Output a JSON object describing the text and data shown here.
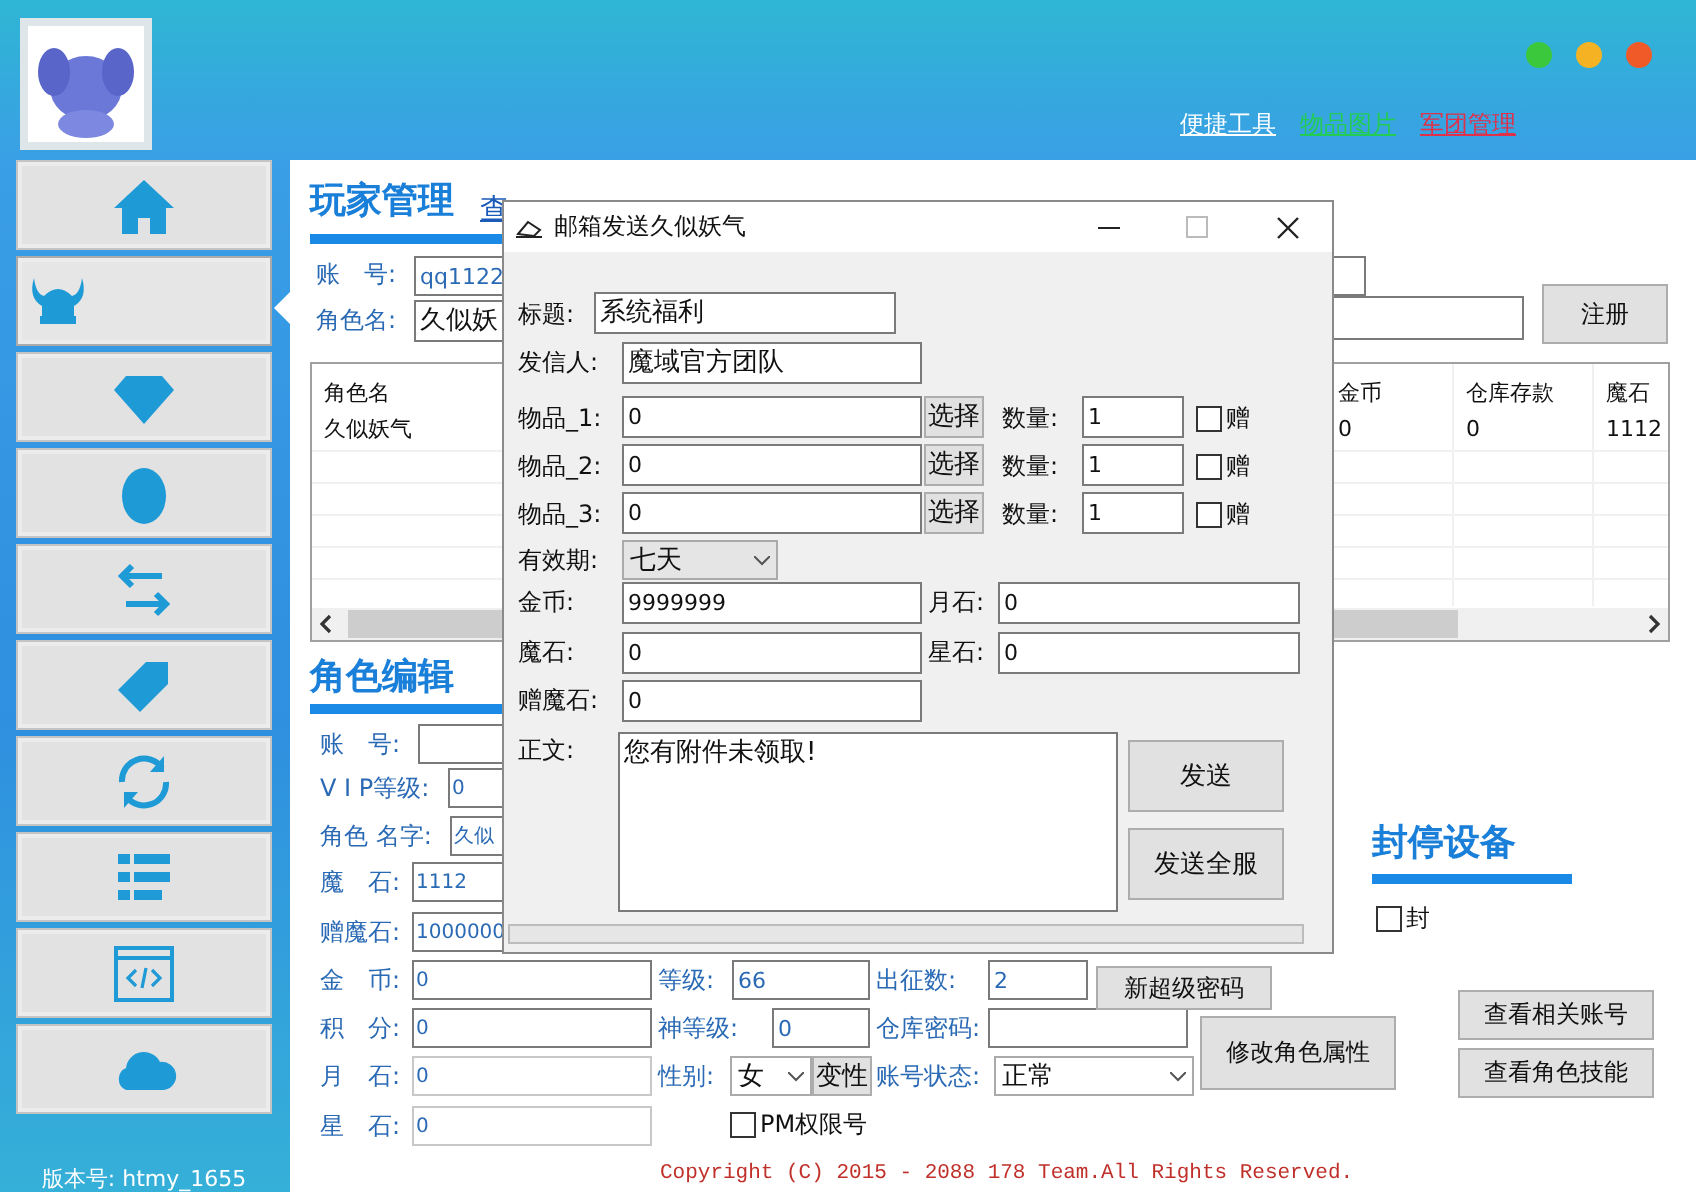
{
  "header": {
    "links": [
      {
        "label": "便捷工具",
        "color": "#ffffff"
      },
      {
        "label": "物品图片",
        "color": "#22cc55"
      },
      {
        "label": "军团管理",
        "color": "#e0304a"
      }
    ]
  },
  "sidebar": {
    "items": [
      {
        "selected": false
      },
      {
        "selected": true
      },
      {
        "selected": false
      },
      {
        "selected": false
      },
      {
        "selected": false
      },
      {
        "selected": false
      },
      {
        "selected": false
      },
      {
        "selected": false
      },
      {
        "selected": false
      },
      {
        "selected": false
      }
    ],
    "version": "版本号: htmy_1655"
  },
  "player_management": {
    "title": "玩家管理",
    "link": "查",
    "account_label": "账　号:",
    "account_value": "qq1122",
    "role_label": "角色名:",
    "role_value": "久似妖"
  },
  "register": {
    "button": "注册"
  },
  "table": {
    "columns": [
      "角色名",
      "金币",
      "仓库存款",
      "魔石"
    ],
    "rows": [
      [
        "久似妖气",
        "0",
        "0",
        "1112"
      ]
    ]
  },
  "role_edit": {
    "title": "角色编辑",
    "fields": [
      {
        "label": "账　号:"
      },
      {
        "label": "V I P等级:",
        "value": "0"
      },
      {
        "label": "角色 名字:",
        "value": "久似"
      },
      {
        "label": "魔　石:",
        "value": "1112"
      },
      {
        "label": "赠魔石:",
        "value": "1000000"
      },
      {
        "label": "金　币:",
        "value": "0"
      },
      {
        "label": "积　分:",
        "value": "0"
      },
      {
        "label": "月　石:",
        "value": "0"
      },
      {
        "label": "星　石:",
        "value": "0"
      }
    ],
    "level": {
      "label": "等级:",
      "value": "66"
    },
    "god_level": {
      "label": "神等级:",
      "value": "0"
    },
    "gender": {
      "label": "性别:",
      "value": "女",
      "button": "变性"
    },
    "pm": {
      "label": "PM权限号",
      "checked": false
    },
    "sorties": {
      "label": "出征数:",
      "value": "2"
    },
    "warehouse_password": {
      "label": "仓库密码:"
    },
    "account_status": {
      "label": "账号状态:",
      "value": "正常"
    },
    "buttons": [
      "新超级密码",
      "修改角色属性",
      "查看相关账号",
      "查看角色技能"
    ]
  },
  "ban_device": {
    "title": "封停设备",
    "checkbox": {
      "label": "封",
      "checked": false
    }
  },
  "copyright": "Copyright (C) 2015 - 2088 178 Team.All Rights Reserved.",
  "dialog": {
    "title": "邮箱发送久似妖气",
    "subject": {
      "label": "标题:",
      "value": "系统福利"
    },
    "sender": {
      "label": "发信人:",
      "value": "魔域官方团队"
    },
    "items": [
      {
        "label": "物品_1:",
        "value": "0",
        "button": "选择",
        "quantity_label": "数量:",
        "quantity": "1",
        "gift_label": "赠",
        "gift_checked": false
      },
      {
        "label": "物品_2:",
        "value": "0",
        "button": "选择",
        "quantity_label": "数量:",
        "quantity": "1",
        "gift_label": "赠",
        "gift_checked": false
      },
      {
        "label": "物品_3:",
        "value": "0",
        "button": "选择",
        "quantity_label": "数量:",
        "quantity": "1",
        "gift_label": "赠",
        "gift_checked": false
      }
    ],
    "validity": {
      "label": "有效期:",
      "value": "七天"
    },
    "currencies": [
      {
        "label": "金币:",
        "value": "9999999"
      },
      {
        "label": "月石:",
        "value": "0"
      },
      {
        "label": "魔石:",
        "value": "0"
      },
      {
        "label": "星石:",
        "value": "0"
      },
      {
        "label": "赠魔石:",
        "value": "0"
      }
    ],
    "body": {
      "label": "正文:",
      "value": "您有附件未领取!"
    },
    "buttons": [
      "发送",
      "发送全服"
    ],
    "progress": {
      "level": 0
    }
  }
}
